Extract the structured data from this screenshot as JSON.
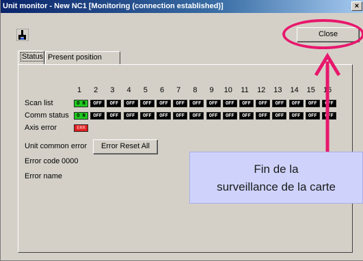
{
  "window": {
    "title": "Unit monitor - New NC1 [Monitoring (connection established)]",
    "close_glyph": "×"
  },
  "toolbar": {
    "close_label": "Close",
    "tool_icon": "unit-tool-icon"
  },
  "tabs": [
    {
      "label": "Status",
      "selected": true
    },
    {
      "label": "Present position",
      "selected": false
    }
  ],
  "status": {
    "unit_numbers": [
      "1",
      "2",
      "3",
      "4",
      "5",
      "6",
      "7",
      "8",
      "9",
      "10",
      "11",
      "12",
      "13",
      "14",
      "15",
      "16"
    ],
    "rows": [
      {
        "label": "Scan list",
        "leds": [
          "ON",
          "OFF",
          "OFF",
          "OFF",
          "OFF",
          "OFF",
          "OFF",
          "OFF",
          "OFF",
          "OFF",
          "OFF",
          "OFF",
          "OFF",
          "OFF",
          "OFF",
          "OFF"
        ]
      },
      {
        "label": "Comm status",
        "leds": [
          "ON",
          "OFF",
          "OFF",
          "OFF",
          "OFF",
          "OFF",
          "OFF",
          "OFF",
          "OFF",
          "OFF",
          "OFF",
          "OFF",
          "OFF",
          "OFF",
          "OFF",
          "OFF"
        ]
      },
      {
        "label": "Axis error",
        "leds": [
          "ERR"
        ]
      }
    ],
    "unit_common_error_label": "Unit common error",
    "error_reset_label": "Error Reset All",
    "error_code_label": "Error code",
    "error_code_value": "0000",
    "error_name_label": "Error name"
  },
  "led_colors": {
    "on": "#1ec81e",
    "off": "#000000",
    "err": "#e01e1e"
  },
  "annotation": {
    "line1": "Fin de la",
    "line2": "surveillance de la carte",
    "color": "#e8176c",
    "callout_bg": "#cfd3fb"
  }
}
